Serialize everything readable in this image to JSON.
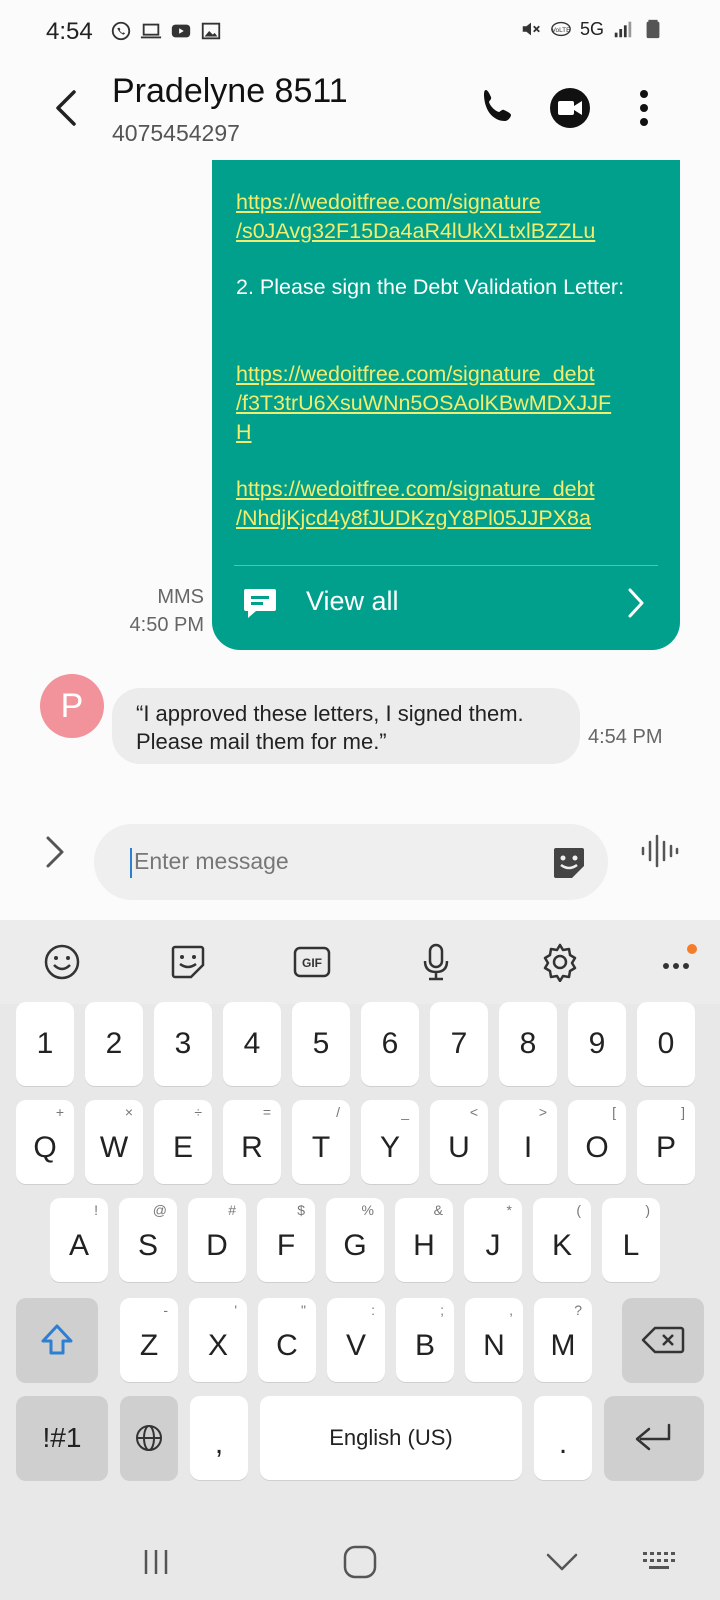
{
  "status_bar": {
    "time": "4:54",
    "network": "5G",
    "left_icons": [
      "whatsapp-icon",
      "laptop-icon",
      "youtube-icon",
      "gallery-icon"
    ],
    "right_icons": [
      "mute-icon",
      "volte-icon",
      "signal-icon",
      "battery-icon"
    ]
  },
  "header": {
    "contact_name": "Pradelyne 8511",
    "contact_number": "4075454297"
  },
  "messages": {
    "sent": {
      "link1_a": "https://wedoitfree.com/signature",
      "link1_b": "/s0JAvg32F15Da4aR4lUkXLtxlBZZLu",
      "text1": "2. Please sign the Debt Validation Letter:",
      "link2_a": "https://wedoitfree.com/signature_debt",
      "link2_b": "/f3T3trU6XsuWNn5OSAolKBwMDXJJF",
      "link2_c": "H",
      "link3_a": "https://wedoitfree.com/signature_debt",
      "link3_b": "/NhdjKjcd4y8fJUDKzgY8Pl05JJPX8a",
      "view_all": "View all",
      "type_label": "MMS",
      "time": "4:50 PM"
    },
    "received": {
      "avatar_letter": "P",
      "text": "“I approved these letters, I signed them. Please mail them for me.”",
      "time": "4:54 PM"
    }
  },
  "composer": {
    "placeholder": "Enter message"
  },
  "keyboard": {
    "numbers": [
      "1",
      "2",
      "3",
      "4",
      "5",
      "6",
      "7",
      "8",
      "9",
      "0"
    ],
    "row1": [
      {
        "k": "Q",
        "h": "+"
      },
      {
        "k": "W",
        "h": "×"
      },
      {
        "k": "E",
        "h": "÷"
      },
      {
        "k": "R",
        "h": "="
      },
      {
        "k": "T",
        "h": "/"
      },
      {
        "k": "Y",
        "h": "_"
      },
      {
        "k": "U",
        "h": "<"
      },
      {
        "k": "I",
        "h": ">"
      },
      {
        "k": "O",
        "h": "["
      },
      {
        "k": "P",
        "h": "]"
      }
    ],
    "row2": [
      {
        "k": "A",
        "h": "!"
      },
      {
        "k": "S",
        "h": "@"
      },
      {
        "k": "D",
        "h": "#"
      },
      {
        "k": "F",
        "h": "$"
      },
      {
        "k": "G",
        "h": "%"
      },
      {
        "k": "H",
        "h": "&"
      },
      {
        "k": "J",
        "h": "*"
      },
      {
        "k": "K",
        "h": "("
      },
      {
        "k": "L",
        "h": ")"
      }
    ],
    "row3": [
      {
        "k": "Z",
        "h": "-"
      },
      {
        "k": "X",
        "h": "'"
      },
      {
        "k": "C",
        "h": "\""
      },
      {
        "k": "V",
        "h": ":"
      },
      {
        "k": "B",
        "h": ";"
      },
      {
        "k": "N",
        "h": ","
      },
      {
        "k": "M",
        "h": "?"
      }
    ],
    "symbols_key": "!#1",
    "comma_key": ",",
    "space_key": "English (US)",
    "period_key": "."
  },
  "colors": {
    "sent_bubble": "#00a08c",
    "link": "#f2ec6f",
    "avatar": "#f2939b",
    "caret": "#2d7fd1",
    "notification_dot": "#f57c2a"
  }
}
